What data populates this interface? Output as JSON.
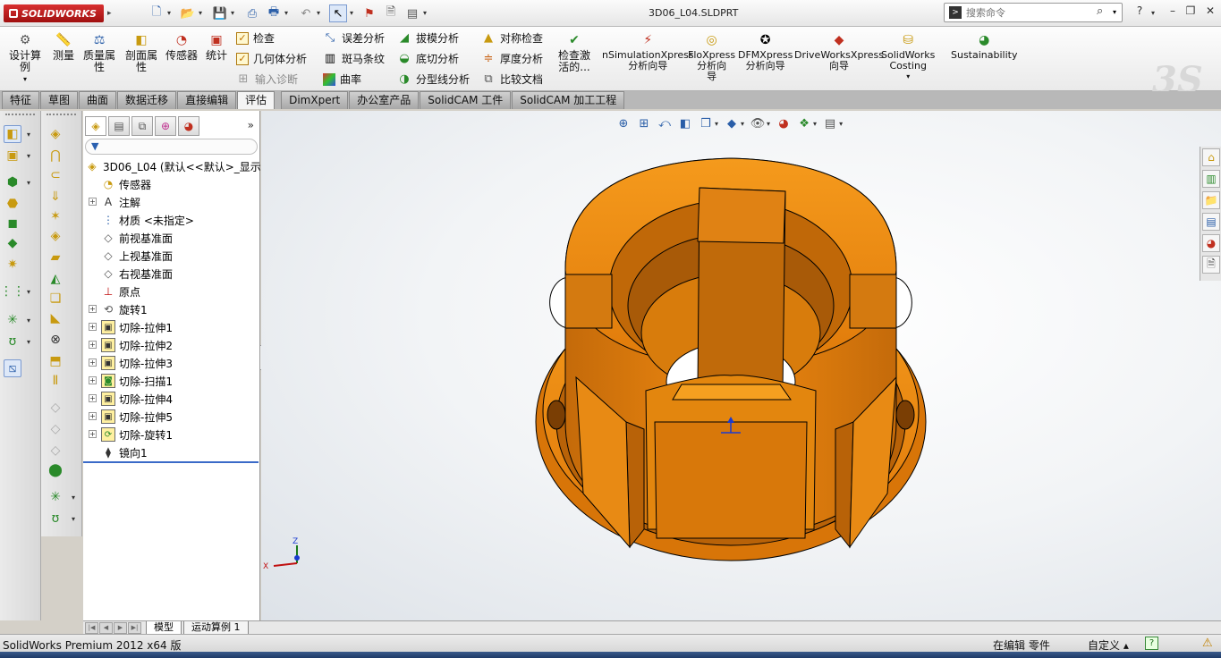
{
  "app": {
    "brand": "SOLIDWORKS",
    "document_title": "3D06_L04.SLDPRT",
    "search": {
      "placeholder": "搜索命令"
    }
  },
  "ribbon": {
    "big_buttons": [
      {
        "label": "设计算\n例",
        "icon": "design-study-icon"
      },
      {
        "label": "测量",
        "icon": "measure-icon"
      },
      {
        "label": "质量属\n性",
        "icon": "mass-properties-icon"
      },
      {
        "label": "剖面属\n性",
        "icon": "section-properties-icon"
      },
      {
        "label": "传感器",
        "icon": "sensor-icon"
      },
      {
        "label": "统计",
        "icon": "statistics-icon"
      }
    ],
    "check_group": [
      {
        "label": "检查",
        "icon": "check-icon",
        "enabled": true
      },
      {
        "label": "几何体分析",
        "icon": "geometry-analysis-icon",
        "enabled": true
      },
      {
        "label": "输入诊断",
        "icon": "import-diagnostics-icon",
        "enabled": false
      }
    ],
    "analysis_col1": [
      {
        "label": "误差分析",
        "icon": "deviation-analysis-icon"
      },
      {
        "label": "斑马条纹",
        "icon": "zebra-stripes-icon"
      },
      {
        "label": "曲率",
        "icon": "curvature-icon"
      }
    ],
    "analysis_col2": [
      {
        "label": "拔模分析",
        "icon": "draft-analysis-icon"
      },
      {
        "label": "底切分析",
        "icon": "undercut-analysis-icon"
      },
      {
        "label": "分型线分析",
        "icon": "parting-line-analysis-icon"
      }
    ],
    "analysis_col3": [
      {
        "label": "对称检查",
        "icon": "symmetry-check-icon"
      },
      {
        "label": "厚度分析",
        "icon": "thickness-analysis-icon"
      },
      {
        "label": "比较文档",
        "icon": "compare-documents-icon"
      }
    ],
    "check_active": {
      "label": "检查激\n活的...",
      "icon": "check-active-icon"
    },
    "xpress": [
      {
        "label": "nSimulationXpress\n分析向导",
        "icon": "simulation-xpress-icon"
      },
      {
        "label": "FloXpress\n分析向\n导",
        "icon": "floxpress-icon"
      },
      {
        "label": "DFMXpress\n分析向导",
        "icon": "dfmxpress-icon"
      },
      {
        "label": "DriveWorksXpress\n向导",
        "icon": "driveworks-xpress-icon"
      },
      {
        "label": "SolidWorks\nCosting",
        "icon": "costing-icon"
      },
      {
        "label": "Sustainability",
        "icon": "sustainability-icon"
      }
    ]
  },
  "tabs": [
    {
      "label": "特征",
      "active": false
    },
    {
      "label": "草图",
      "active": false
    },
    {
      "label": "曲面",
      "active": false
    },
    {
      "label": "数据迁移",
      "active": false
    },
    {
      "label": "直接编辑",
      "active": false
    },
    {
      "label": "评估",
      "active": true
    },
    {
      "label": "DimXpert",
      "active": false
    },
    {
      "label": "办公室产品",
      "active": false
    },
    {
      "label": "SolidCAM 工件",
      "active": false
    },
    {
      "label": "SolidCAM 加工工程",
      "active": false
    }
  ],
  "feature_tree": {
    "root": "3D06_L04  (默认<<默认>_显示",
    "nodes": [
      {
        "label": "传感器",
        "icon": "sensor-icon",
        "expandable": false
      },
      {
        "label": "注解",
        "icon": "annotations-icon",
        "expandable": true
      },
      {
        "label": "材质 <未指定>",
        "icon": "material-icon",
        "expandable": false
      },
      {
        "label": "前视基准面",
        "icon": "plane-icon",
        "expandable": false
      },
      {
        "label": "上视基准面",
        "icon": "plane-icon",
        "expandable": false
      },
      {
        "label": "右视基准面",
        "icon": "plane-icon",
        "expandable": false
      },
      {
        "label": "原点",
        "icon": "origin-icon",
        "expandable": false
      },
      {
        "label": "旋转1",
        "icon": "revolve-icon",
        "expandable": true
      },
      {
        "label": "切除-拉伸1",
        "icon": "cut-extrude-icon",
        "expandable": true
      },
      {
        "label": "切除-拉伸2",
        "icon": "cut-extrude-icon",
        "expandable": true
      },
      {
        "label": "切除-拉伸3",
        "icon": "cut-extrude-icon",
        "expandable": true
      },
      {
        "label": "切除-扫描1",
        "icon": "cut-sweep-icon",
        "expandable": true
      },
      {
        "label": "切除-拉伸4",
        "icon": "cut-extrude-icon",
        "expandable": true
      },
      {
        "label": "切除-拉伸5",
        "icon": "cut-extrude-icon",
        "expandable": true
      },
      {
        "label": "切除-旋转1",
        "icon": "cut-revolve-icon",
        "expandable": true
      },
      {
        "label": "镜向1",
        "icon": "mirror-icon",
        "expandable": false
      }
    ]
  },
  "triad": {
    "x": "X",
    "z": "Z"
  },
  "bottom_tabs": [
    {
      "label": "模型",
      "active": true
    },
    {
      "label": "运动算例 1",
      "active": false
    }
  ],
  "status": {
    "product": "SolidWorks Premium 2012 x64 版",
    "mode": "在编辑 零件",
    "units": "自定义"
  },
  "colors": {
    "part_orange": "#e8820c",
    "part_dark": "#a85a08",
    "accent_blue": "#3a6ac8"
  }
}
